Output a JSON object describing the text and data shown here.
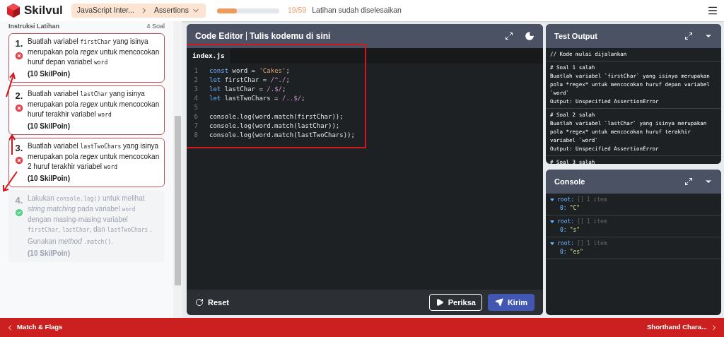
{
  "header": {
    "brand": "Skilvul",
    "breadcrumb": {
      "course": "JavaScript Inter...",
      "lesson": "Assertions"
    },
    "progress": {
      "level": 0.32,
      "count": "19/59",
      "label": "Latihan sudah diselesaikan"
    }
  },
  "instructions": {
    "title": "Instruksi Latihan",
    "count": "4 Soal",
    "tasks": [
      {
        "number": "1.",
        "passed": false,
        "points": "(10 SkilPoin)",
        "paragraphs": [
          [
            {
              "kind": "text",
              "t": "Buatlah variabel "
            },
            {
              "kind": "code",
              "t": "firstChar"
            },
            {
              "kind": "text",
              "t": " yang isinya merupakan pola "
            },
            {
              "kind": "italic",
              "t": "regex"
            },
            {
              "kind": "text",
              "t": " untuk mencocokan huruf depan variabel "
            },
            {
              "kind": "code",
              "t": "word"
            }
          ]
        ]
      },
      {
        "number": "2.",
        "passed": false,
        "points": "(10 SkilPoin)",
        "paragraphs": [
          [
            {
              "kind": "text",
              "t": "Buatlah variabel "
            },
            {
              "kind": "code",
              "t": "lastChar"
            },
            {
              "kind": "text",
              "t": " yang isinya merupakan pola "
            },
            {
              "kind": "italic",
              "t": "regex"
            },
            {
              "kind": "text",
              "t": " untuk mencocokan huruf terakhir variabel "
            },
            {
              "kind": "code",
              "t": "word"
            }
          ]
        ]
      },
      {
        "number": "3.",
        "passed": false,
        "points": "(10 SkilPoin)",
        "paragraphs": [
          [
            {
              "kind": "text",
              "t": "Buatlah variabel "
            },
            {
              "kind": "code",
              "t": "lastTwoChars"
            },
            {
              "kind": "text",
              "t": " yang isinya merupakan pola "
            },
            {
              "kind": "italic",
              "t": "regex"
            },
            {
              "kind": "text",
              "t": " untuk mencocokan 2 huruf terakhir variabel "
            },
            {
              "kind": "code",
              "t": "word"
            }
          ]
        ]
      },
      {
        "number": "4.",
        "passed": true,
        "points": "(10 SkilPoin)",
        "paragraphs": [
          [
            {
              "kind": "text",
              "t": "Lakukan "
            },
            {
              "kind": "code",
              "t": "console.log()"
            },
            {
              "kind": "text",
              "t": " untuk melihat "
            },
            {
              "kind": "italic",
              "t": "string matching"
            },
            {
              "kind": "text",
              "t": " pada variabel "
            },
            {
              "kind": "code",
              "t": "word"
            },
            {
              "kind": "text",
              "t": " dengan masing-masing variabel "
            },
            {
              "kind": "code",
              "t": "firstChar"
            },
            {
              "kind": "text",
              "t": ", "
            },
            {
              "kind": "code",
              "t": "lastChar"
            },
            {
              "kind": "text",
              "t": ", dan "
            },
            {
              "kind": "code",
              "t": "lastTwoChars"
            },
            {
              "kind": "text",
              "t": " ."
            }
          ],
          [
            {
              "kind": "text",
              "t": "Gunakan "
            },
            {
              "kind": "italic",
              "t": "method "
            },
            {
              "kind": "code",
              "t": ".match()"
            },
            {
              "kind": "text",
              "t": "."
            }
          ]
        ]
      }
    ]
  },
  "editor": {
    "title": "Code Editor",
    "subtitle": "Tulis kodemu di sini",
    "file_tab": "index.js",
    "lines": [
      {
        "number": "1",
        "tokens": [
          {
            "kind": "keyword",
            "t": "const"
          },
          {
            "kind": "plain",
            "t": " word = "
          },
          {
            "kind": "string",
            "t": "'Cakes'"
          },
          {
            "kind": "plain",
            "t": ";"
          }
        ]
      },
      {
        "number": "2",
        "tokens": [
          {
            "kind": "keyword",
            "t": "let"
          },
          {
            "kind": "plain",
            "t": " firstChar = "
          },
          {
            "kind": "regex",
            "t": "/^./"
          },
          {
            "kind": "plain",
            "t": ";"
          }
        ]
      },
      {
        "number": "3",
        "tokens": [
          {
            "kind": "keyword",
            "t": "let"
          },
          {
            "kind": "plain",
            "t": " lastChar = "
          },
          {
            "kind": "regex",
            "t": "/.$/"
          },
          {
            "kind": "plain",
            "t": ";"
          }
        ]
      },
      {
        "number": "4",
        "tokens": [
          {
            "kind": "keyword",
            "t": "let"
          },
          {
            "kind": "plain",
            "t": " lastTwoChars = "
          },
          {
            "kind": "regex",
            "t": "/..$/"
          },
          {
            "kind": "plain",
            "t": ";"
          }
        ]
      },
      {
        "number": "5"
      },
      {
        "number": "6",
        "tokens": [
          {
            "kind": "plain",
            "t": "console.log(word.match(firstChar));"
          }
        ]
      },
      {
        "number": "7",
        "tokens": [
          {
            "kind": "plain",
            "t": "console.log(word.match(lastChar));"
          }
        ]
      },
      {
        "number": "8",
        "tokens": [
          {
            "kind": "plain",
            "t": "console.log(word.match(lastTwoChars));"
          }
        ]
      }
    ],
    "buttons": {
      "reset": "Reset",
      "check": "Periksa",
      "submit": "Kirim"
    }
  },
  "test_output": {
    "title": "Test Output",
    "blocks": [
      [
        "// Kode mulai dijalankan"
      ],
      [
        "# Soal 1 salah",
        "Buatlah variabel `firstChar` yang isinya merupakan pola *regex* untuk mencocokan huruf depan variabel `word`",
        "Output: Unspecified AssertionError"
      ],
      [
        "# Soal 2 salah",
        "Buatlah variabel `lastChar` yang isinya merupakan pola *regex* untuk mencocokan huruf terakhir variabel `word`",
        "Output: Unspecified AssertionError"
      ],
      [
        "# Soal 3 salah"
      ]
    ]
  },
  "console": {
    "title": "Console",
    "entries": [
      {
        "key": "root:",
        "type": "[]",
        "count": "1 item",
        "index": "0:",
        "value": "\"C\""
      },
      {
        "key": "root:",
        "type": "[]",
        "count": "1 item",
        "index": "0:",
        "value": "\"s\""
      },
      {
        "key": "root:",
        "type": "[]",
        "count": "1 item",
        "index": "0:",
        "value": "\"es\""
      }
    ]
  },
  "footer": {
    "previous": "Match & Flags",
    "next": "Shorthand Chara..."
  }
}
